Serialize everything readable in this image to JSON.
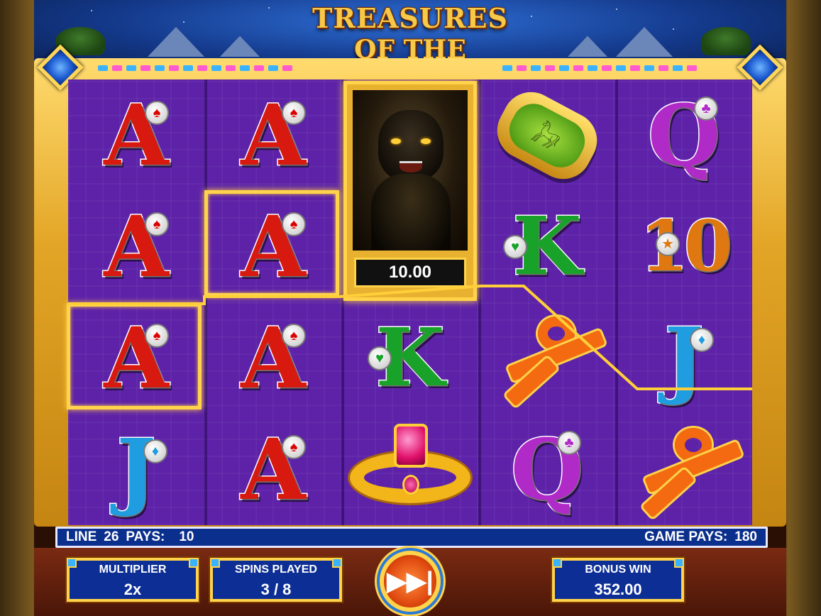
{
  "game": {
    "title_line1": "TREASURES",
    "title_line2": "OF THE PYRAMIDS"
  },
  "reels": [
    [
      {
        "symbol": "A",
        "suit": "♠"
      },
      {
        "symbol": "A",
        "suit": "♠"
      },
      {
        "symbol": "A",
        "suit": "♠"
      },
      {
        "symbol": "J",
        "suit": "♦"
      }
    ],
    [
      {
        "symbol": "A",
        "suit": "♠"
      },
      {
        "symbol": "A",
        "suit": "♠"
      },
      {
        "symbol": "A",
        "suit": "♠"
      },
      {
        "symbol": "A",
        "suit": "♠"
      }
    ],
    [
      {
        "symbol": "panther"
      },
      {
        "symbol": "K",
        "suit": "♥"
      },
      {
        "symbol": "ring"
      }
    ],
    [
      {
        "symbol": "cartouche"
      },
      {
        "symbol": "K",
        "suit": "♥"
      },
      {
        "symbol": "ankh"
      },
      {
        "symbol": "Q",
        "suit": "♣"
      }
    ],
    [
      {
        "symbol": "Q",
        "suit": "♣"
      },
      {
        "symbol": "10",
        "suit": "★"
      },
      {
        "symbol": "J",
        "suit": "♦"
      },
      {
        "symbol": "ankh"
      }
    ]
  ],
  "panther_value": "10.00",
  "info_bar": {
    "line_label": "LINE",
    "line_number": "26",
    "pays_label": "PAYS:",
    "pays_value": "10",
    "game_pays_label": "GAME PAYS:",
    "game_pays_value": "180"
  },
  "panels": {
    "multiplier": {
      "label": "MULTIPLIER",
      "value": "2x"
    },
    "spins_played": {
      "label": "SPINS PLAYED",
      "value": "3 / 8"
    },
    "bonus_win": {
      "label": "BONUS WIN",
      "value": "352.00"
    }
  },
  "controls": {
    "skip_icon": "fast-forward-skip-icon"
  },
  "colors": {
    "grid_bg": "#5d22a8",
    "frame_gold": "#e3a526",
    "info_bar_bg": "#0b2f8c",
    "highlight": "#ffd34a"
  }
}
